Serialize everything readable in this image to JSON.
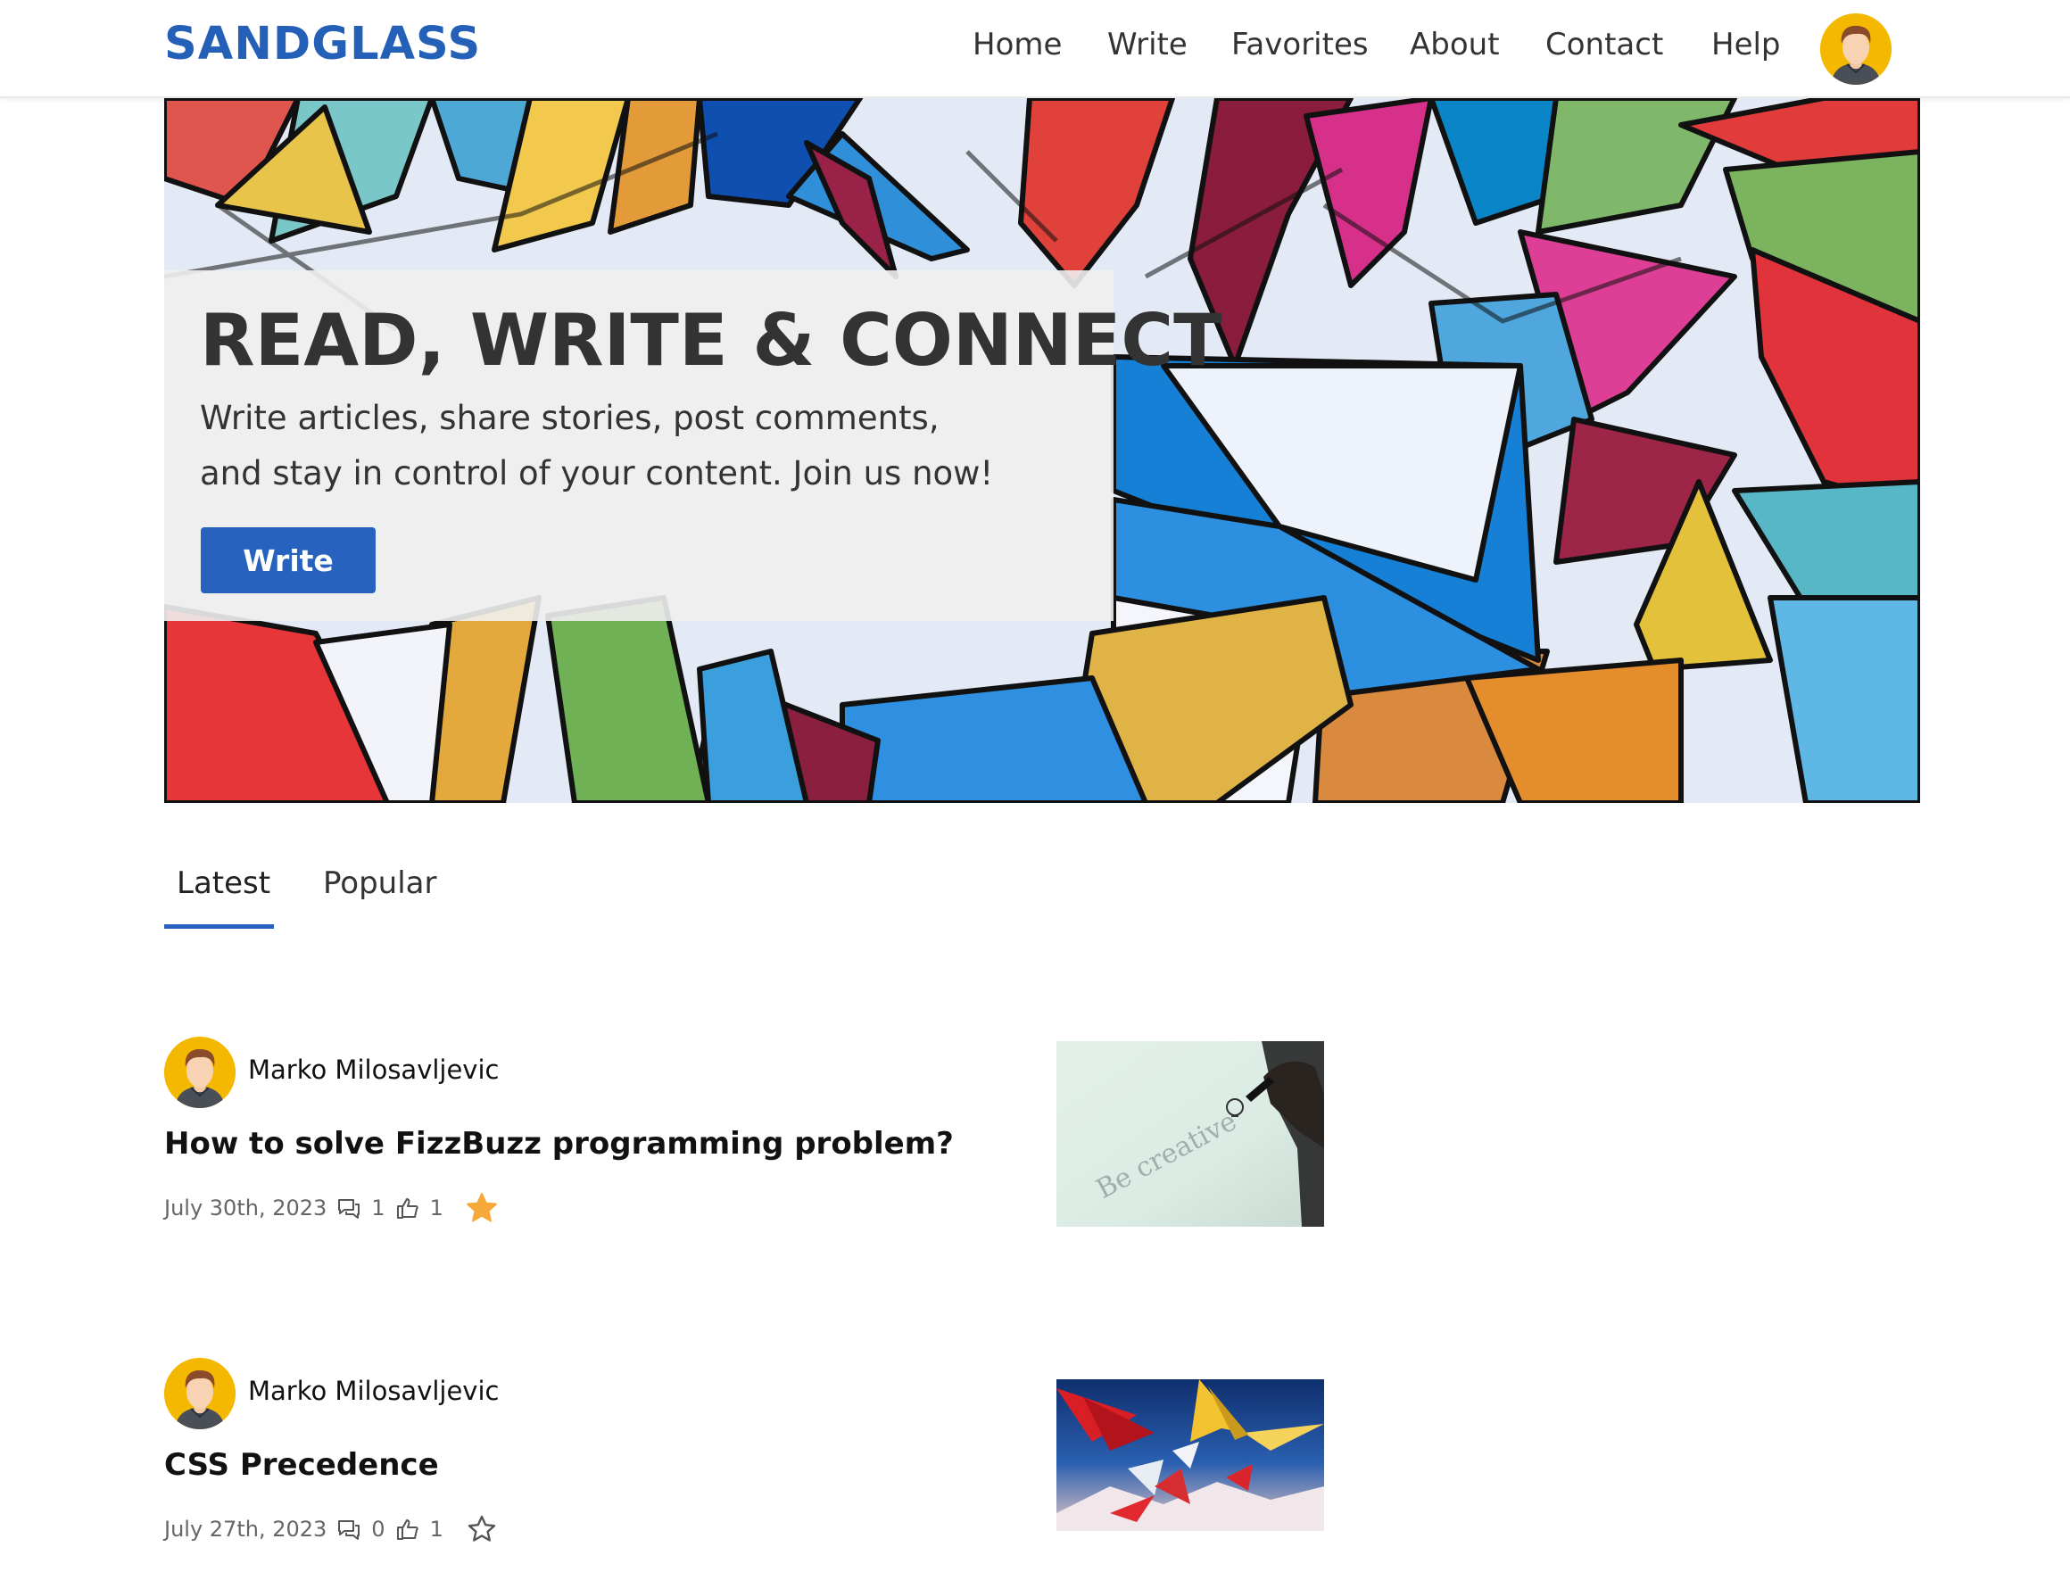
{
  "header": {
    "logo": "SANDGLASS",
    "nav": [
      {
        "label": "Home"
      },
      {
        "label": "Write"
      },
      {
        "label": "Favorites"
      },
      {
        "label": "About"
      },
      {
        "label": "Contact"
      },
      {
        "label": "Help"
      }
    ],
    "avatar_icon": "user-avatar-icon"
  },
  "hero": {
    "title": "READ, WRITE & CONNECT",
    "subtitle_line1": "Write articles, share stories, post comments,",
    "subtitle_line2": "and stay in control of your content. Join us now!",
    "button_label": "Write"
  },
  "tabs": [
    {
      "label": "Latest",
      "active": true
    },
    {
      "label": "Popular",
      "active": false
    }
  ],
  "posts": [
    {
      "author": "Marko Milosavljevic",
      "title": "How to solve FizzBuzz programming problem?",
      "date": "July 30th, 2023",
      "comments": "1",
      "likes": "1",
      "favorited": true,
      "thumbnail_icon": "be-creative-image"
    },
    {
      "author": "Marko Milosavljevic",
      "title": "CSS Precedence",
      "date": "July 27th, 2023",
      "comments": "0",
      "likes": "1",
      "favorited": false,
      "thumbnail_icon": "paper-planes-image"
    }
  ],
  "colors": {
    "brand": "#2560b8",
    "button": "#2762bf",
    "favorite_star": "#f7a83a",
    "avatar_bg": "#f5b800"
  }
}
